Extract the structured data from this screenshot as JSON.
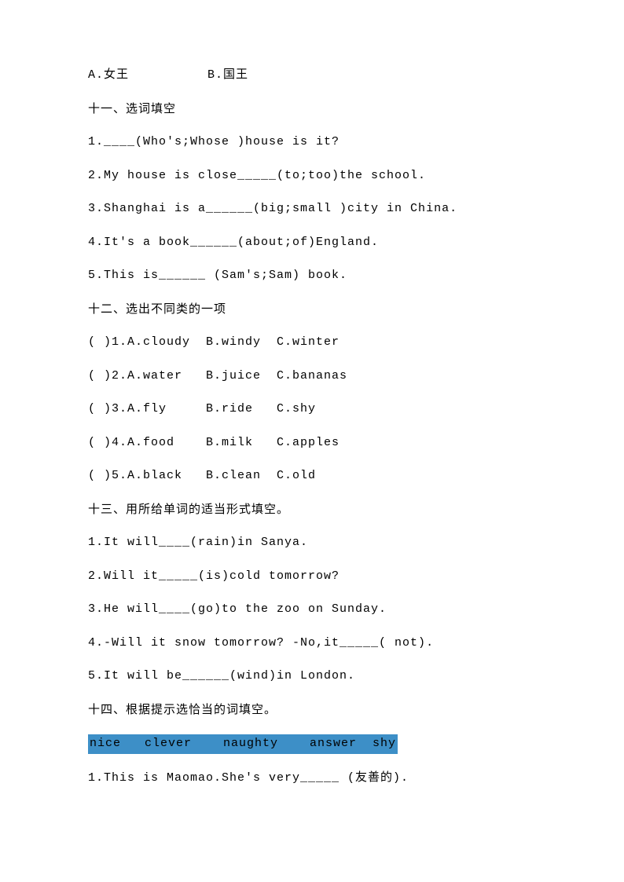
{
  "lines": {
    "l0": "A.女王          B.国王",
    "l1": "十一、选词填空",
    "l2": "1.____(Who's;Whose )house is it?",
    "l3": "2.My house is close_____(to;too)the school.",
    "l4": "3.Shanghai is a______(big;small )city in China.",
    "l5": "4.It's a book______(about;of)England.",
    "l6": "5.This is______ (Sam's;Sam) book.",
    "l7": "十二、选出不同类的一项",
    "l8": "( )1.A.cloudy  B.windy  C.winter",
    "l9": "( )2.A.water   B.juice  C.bananas",
    "l10": "( )3.A.fly     B.ride   C.shy",
    "l11": "( )4.A.food    B.milk   C.apples",
    "l12": "( )5.A.black   B.clean  C.old",
    "l13": "十三、用所给单词的适当形式填空。",
    "l14": "1.It will____(rain)in Sanya.",
    "l15": "2.Will it_____(is)cold tomorrow?",
    "l16": "3.He will____(go)to the zoo on Sunday.",
    "l17": "4.-Will it snow tomorrow? -No,it_____( not).",
    "l18": "5.It will be______(wind)in London.",
    "l19": "十四、根据提示选恰当的词填空。",
    "l20": "nice   clever    naughty    answer  shy",
    "l21": "1.This is Maomao.She's very_____ (友善的)."
  }
}
